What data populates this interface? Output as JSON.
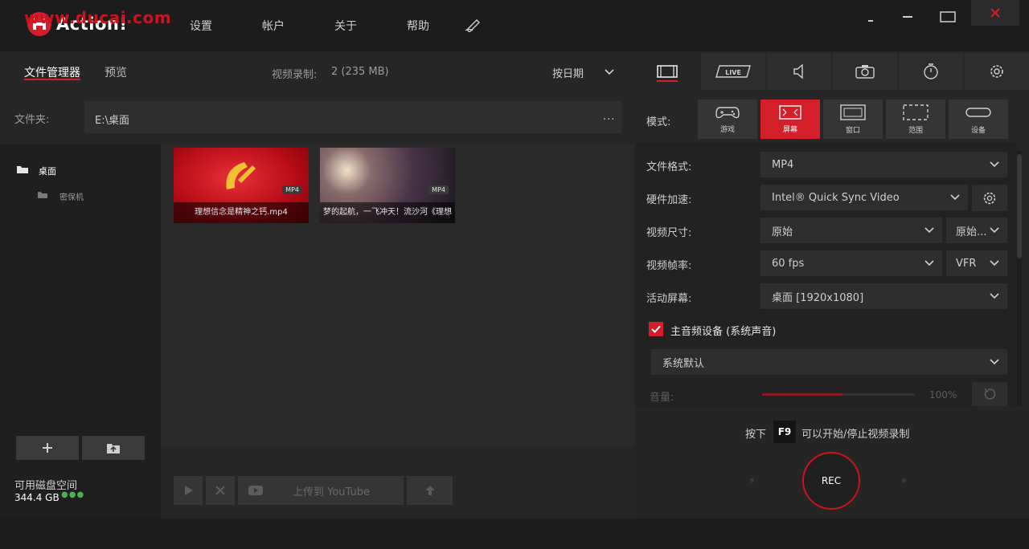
{
  "app": {
    "title": "Action!",
    "watermark": "www.ducai.com",
    "menu": [
      "设置",
      "帐户",
      "关于",
      "帮助"
    ],
    "menu_icon": "pen-icon"
  },
  "window_controls": {
    "minimize": "minimize-icon",
    "restore": "restore-icon",
    "close": "close-icon"
  },
  "left": {
    "tabs": {
      "file_manager": "文件管理器",
      "preview": "预览"
    },
    "recordings_label": "视频录制:",
    "recordings_count": "2 (235 MB)",
    "sort_label": "按日期",
    "folder_label": "文件夹:",
    "folder_path": "E:\\桌面",
    "folder_more": "...",
    "tree": [
      {
        "label": "桌面"
      },
      {
        "label": "密保机"
      }
    ],
    "files": [
      {
        "caption": "理想信念是精神之钙.mp4",
        "badge": "MP4"
      },
      {
        "caption": "梦的起航，一飞冲天！流沙河《理想",
        "badge": "MP4"
      }
    ],
    "disk_label": "可用磁盘空间",
    "disk_value": "344.4 GB",
    "disk_dots": "●●●",
    "upload_youtube": "上传到 YouTube"
  },
  "right": {
    "mode_label": "模式:",
    "modes": [
      {
        "label": "游戏",
        "icon": "gamepad-icon"
      },
      {
        "label": "屏幕",
        "icon": "fullscreen-icon"
      },
      {
        "label": "窗口",
        "icon": "window-icon"
      },
      {
        "label": "范围",
        "icon": "region-icon"
      },
      {
        "label": "设备",
        "icon": "device-icon"
      }
    ],
    "settings": {
      "format_label": "文件格式:",
      "format_value": "MP4",
      "hw_label": "硬件加速:",
      "hw_value": "Intel® Quick Sync Video",
      "size_label": "视频尺寸:",
      "size_value": "原始",
      "size_value2": "原始...",
      "fps_label": "视频帧率:",
      "fps_value": "60 fps",
      "fps_mode": "VFR",
      "screen_label": "活动屏幕:",
      "screen_value": "桌面 [1920x1080]",
      "audio_label": "主音频设备 (系统声音)",
      "audio_checked": true,
      "audio_device": "系统默认",
      "volume_label": "音量:",
      "volume_pct": "100%",
      "volume_level": 0.52
    },
    "hint_prefix": "按下",
    "hotkey": "F9",
    "hint_suffix": "可以开始/停止视频录制",
    "rec_label": "REC"
  },
  "colors": {
    "accent": "#d41f2a",
    "background": "#262626",
    "disk_ok": "#4caf50"
  }
}
